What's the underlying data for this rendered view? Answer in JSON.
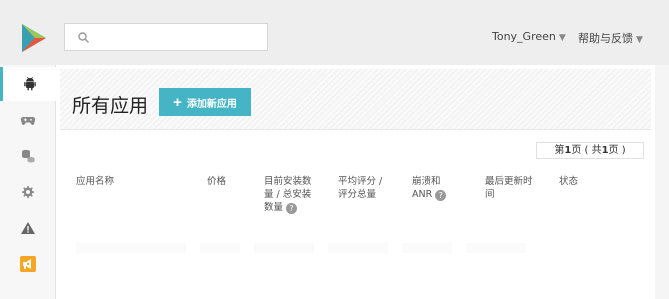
{
  "topbar": {
    "search_placeholder": "",
    "user_name": "Tony_Green",
    "help_label": "帮助与反馈"
  },
  "sidebar": {
    "items": [
      {
        "icon": "android-icon",
        "active": true
      },
      {
        "icon": "gamepad-icon",
        "active": false
      },
      {
        "icon": "coins-icon",
        "active": false
      },
      {
        "icon": "gear-icon",
        "active": false
      },
      {
        "icon": "warning-icon",
        "active": false
      },
      {
        "icon": "announcement-icon",
        "active": false
      }
    ]
  },
  "main": {
    "title": "所有应用",
    "add_button_label": "添加新应用",
    "pagination": {
      "prefix": "第",
      "current": "1",
      "middle": "页 ( 共",
      "total": "1",
      "suffix": "页 )"
    },
    "columns": {
      "name": "应用名称",
      "price": "价格",
      "installs_line1": "目前安装数",
      "installs_line2": "量 / 总安装",
      "installs_line3": "数量",
      "rating_line1": "平均评分 /",
      "rating_line2": "评分总量",
      "crash_line1": "崩溃和",
      "crash_line2": "ANR",
      "updated_line1": "最后更新时",
      "updated_line2": "间",
      "status": "状态"
    }
  },
  "colors": {
    "accent": "#45b5c5",
    "logo_teal": "#4bb6c6"
  }
}
